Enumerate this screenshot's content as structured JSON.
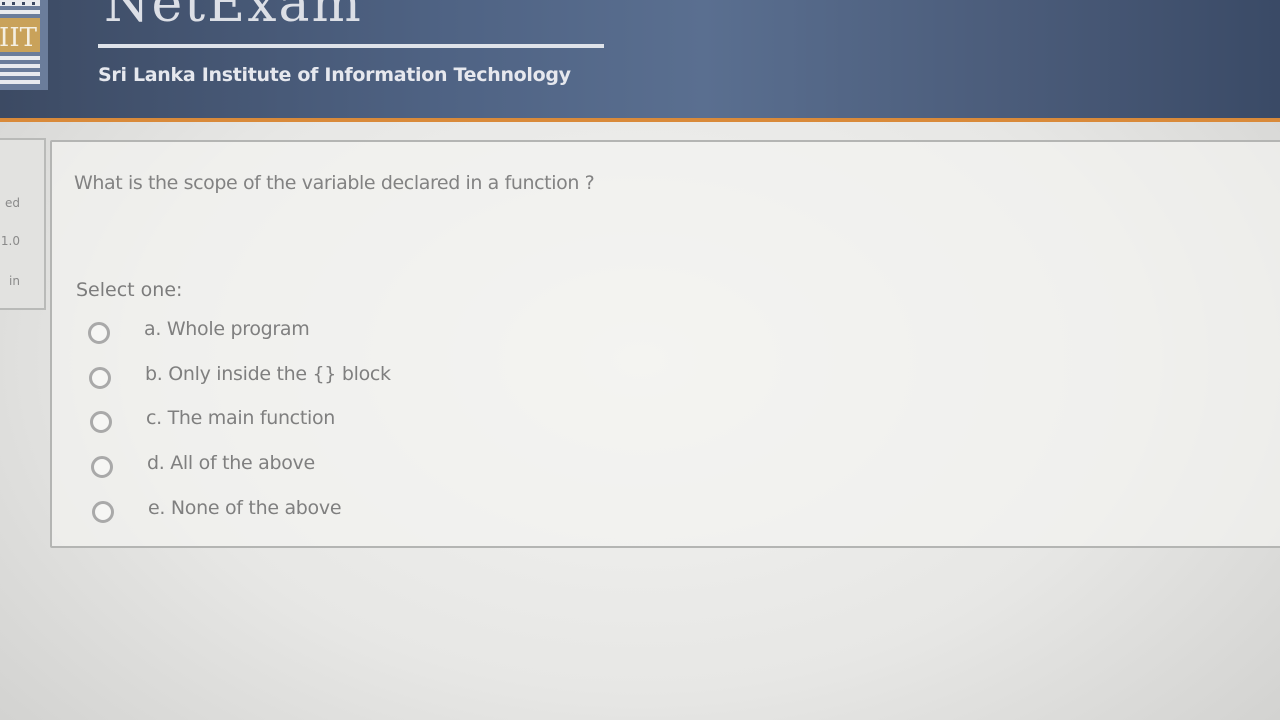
{
  "header": {
    "title": "NetExam",
    "subtitle": "Sri Lanka Institute of Information Technology",
    "logo_text": "IIT"
  },
  "info_panel": {
    "lines": [
      "ed",
      "1.0",
      "in"
    ]
  },
  "question": {
    "text": "What is the scope of the variable declared in a function ?",
    "prompt": "Select one:",
    "options": [
      {
        "label": "a. Whole program"
      },
      {
        "label": "b. Only inside the {} block"
      },
      {
        "label": "c. The main function"
      },
      {
        "label": "d. All of the above"
      },
      {
        "label": "e. None of the above"
      }
    ]
  },
  "colors": {
    "header_bg": "#4f6384",
    "header_accent": "#d98a3a",
    "text_muted": "#7f7f7f"
  }
}
